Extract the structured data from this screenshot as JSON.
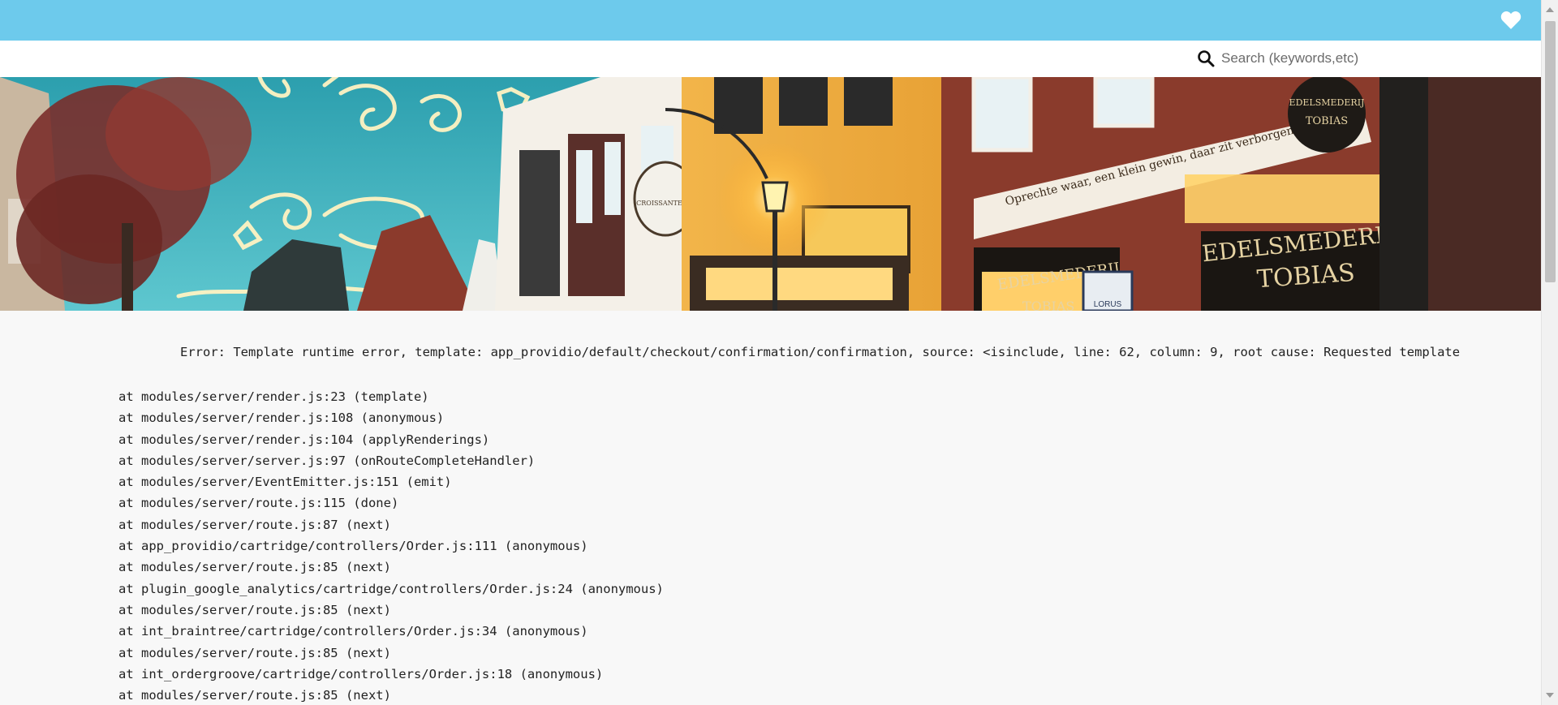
{
  "header": {
    "wishlist_icon": "heart-icon",
    "color": "#6dcaec"
  },
  "search": {
    "icon": "search-icon",
    "placeholder": "Search (keywords,etc)"
  },
  "hero": {
    "image": "christmas-shopping-street-banner",
    "sign_lines": [
      "EDELSMEDERIJ",
      "TOBIAS"
    ],
    "facade_text": "Oprechte waar, een klein gewin, daar zit verborgen zegen in",
    "badge_lines": [
      "EDELSMEDERIJ",
      "TOBIAS"
    ],
    "window_sign_small": "EDELSMEDERIJ",
    "window_sign_small_2": "TOBIAS",
    "teapot_sign": "CROISSANTERIE",
    "box_sign": "LORUS"
  },
  "error": {
    "message": "Error: Template runtime error, template: app_providio/default/checkout/confirmation/confirmation, source: <isinclude, line: 62, column: 9, root cause: Requested template",
    "stack": [
      "at modules/server/render.js:23 (template)",
      "at modules/server/render.js:108 (anonymous)",
      "at modules/server/render.js:104 (applyRenderings)",
      "at modules/server/server.js:97 (onRouteCompleteHandler)",
      "at modules/server/EventEmitter.js:151 (emit)",
      "at modules/server/route.js:115 (done)",
      "at modules/server/route.js:87 (next)",
      "at app_providio/cartridge/controllers/Order.js:111 (anonymous)",
      "at modules/server/route.js:85 (next)",
      "at plugin_google_analytics/cartridge/controllers/Order.js:24 (anonymous)",
      "at modules/server/route.js:85 (next)",
      "at int_braintree/cartridge/controllers/Order.js:34 (anonymous)",
      "at modules/server/route.js:85 (next)",
      "at int_ordergroove/cartridge/controllers/Order.js:18 (anonymous)",
      "at modules/server/route.js:85 (next)"
    ]
  }
}
